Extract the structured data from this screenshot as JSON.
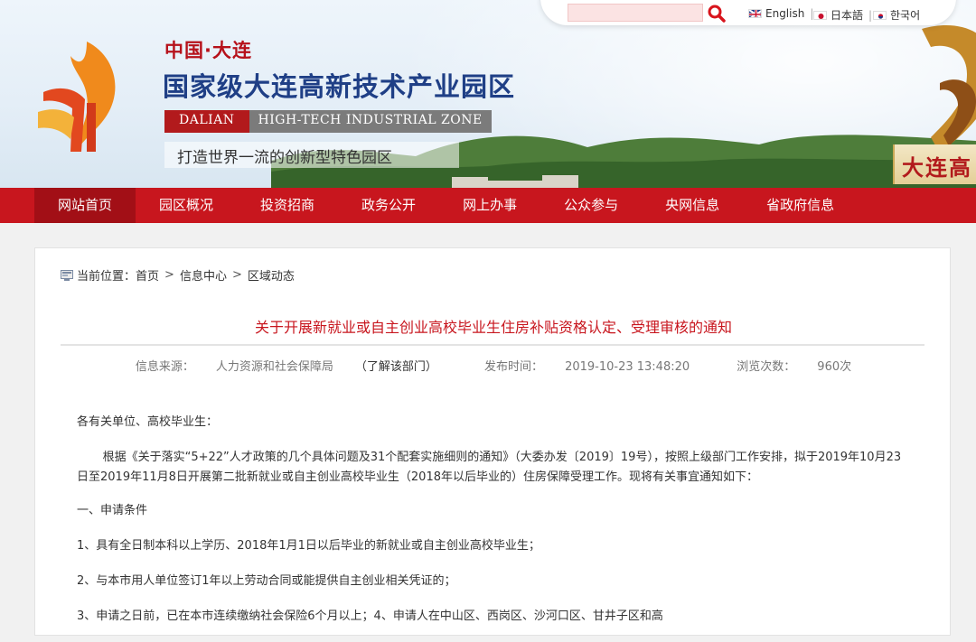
{
  "header": {
    "brand_small": "中国·大连",
    "brand_main": "国家级大连高新技术产业园区",
    "zone_dalian": "DALIAN",
    "zone_name": "HIGH-TECH INDUSTRIAL ZONE",
    "slogan": "打造世界一流的创新型特色园区",
    "corner_text": "大连高"
  },
  "search": {
    "value": ""
  },
  "languages": [
    {
      "label": "English",
      "flag": "uk-flag-icon"
    },
    {
      "label": "日本語",
      "flag": "japan-flag-icon"
    },
    {
      "label": "한국어",
      "flag": "korea-flag-icon"
    }
  ],
  "nav": {
    "items": [
      {
        "label": "网站首页",
        "active": true
      },
      {
        "label": "园区概况"
      },
      {
        "label": "投资招商"
      },
      {
        "label": "政务公开"
      },
      {
        "label": "网上办事"
      },
      {
        "label": "公众参与"
      },
      {
        "label": "央网信息"
      },
      {
        "label": "省政府信息"
      }
    ]
  },
  "breadcrumb": {
    "prefix": "当前位置：",
    "items": [
      "首页",
      "信息中心",
      "区域动态"
    ],
    "separator": ">"
  },
  "article": {
    "title": "关于开展新就业或自主创业高校毕业生住房补贴资格认定、受理审核的通知",
    "source_label": "信息来源：",
    "source_value": "人力资源和社会保障局",
    "dept_link": "（了解该部门）",
    "time_label": "发布时间：",
    "time_value": "2019-10-23 13:48:20",
    "views_label": "浏览次数：",
    "views_value": "960次",
    "paragraphs": [
      "各有关单位、高校毕业生：",
      "根据《关于落实“5+22”人才政策的几个具体问题及31个配套实施细则的通知》（大委办发〔2019〕19号），按照上级部门工作安排，拟于2019年10月23日至2019年11月8日开展第二批新就业或自主创业高校毕业生（2018年以后毕业的）住房保障受理工作。现将有关事宜通知如下：",
      "一、申请条件",
      "1、具有全日制本科以上学历、2018年1月1日以后毕业的新就业或自主创业高校毕业生；",
      "2、与本市用人单位签订1年以上劳动合同或能提供自主创业相关凭证的；",
      "3、申请之日前，已在本市连续缴纳社会保险6个月以上；4、申请人在中山区、西岗区、沙河口区、甘井子区和高"
    ]
  },
  "colors": {
    "brand_red": "#c8161e",
    "brand_blue": "#1f3f86"
  }
}
